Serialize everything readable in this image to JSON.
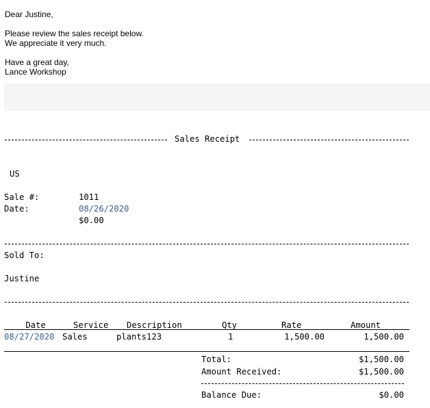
{
  "email": {
    "greeting": "Dear Justine,",
    "intro_line1": "Please review the sales receipt below.",
    "intro_line2": "We appreciate it very much.",
    "signoff_line1": "Have a great day,",
    "signoff_line2": "Lance Workshop"
  },
  "receipt": {
    "title": "Sales Receipt",
    "company_location": "US",
    "sale_label": "Sale #:",
    "sale_number": "1011",
    "date_label": "Date:",
    "date_value": "08/26/2020",
    "amount_value": "$0.00",
    "sold_to_label": "Sold To:",
    "customer_name": "Justine",
    "columns": {
      "date": "Date",
      "service": "Service",
      "description": "Description",
      "qty": "Qty",
      "rate": "Rate",
      "amount": "Amount"
    },
    "line_items": [
      {
        "date": "08/27/2020",
        "service": "Sales",
        "description": "plants123",
        "qty": "1",
        "rate": "1,500.00",
        "amount": "1,500.00"
      }
    ],
    "totals": {
      "total_label": "Total:",
      "total_value": "$1,500.00",
      "received_label": "Amount Received:",
      "received_value": "$1,500.00",
      "balance_label": "Balance Due:",
      "balance_value": "$0.00"
    }
  }
}
